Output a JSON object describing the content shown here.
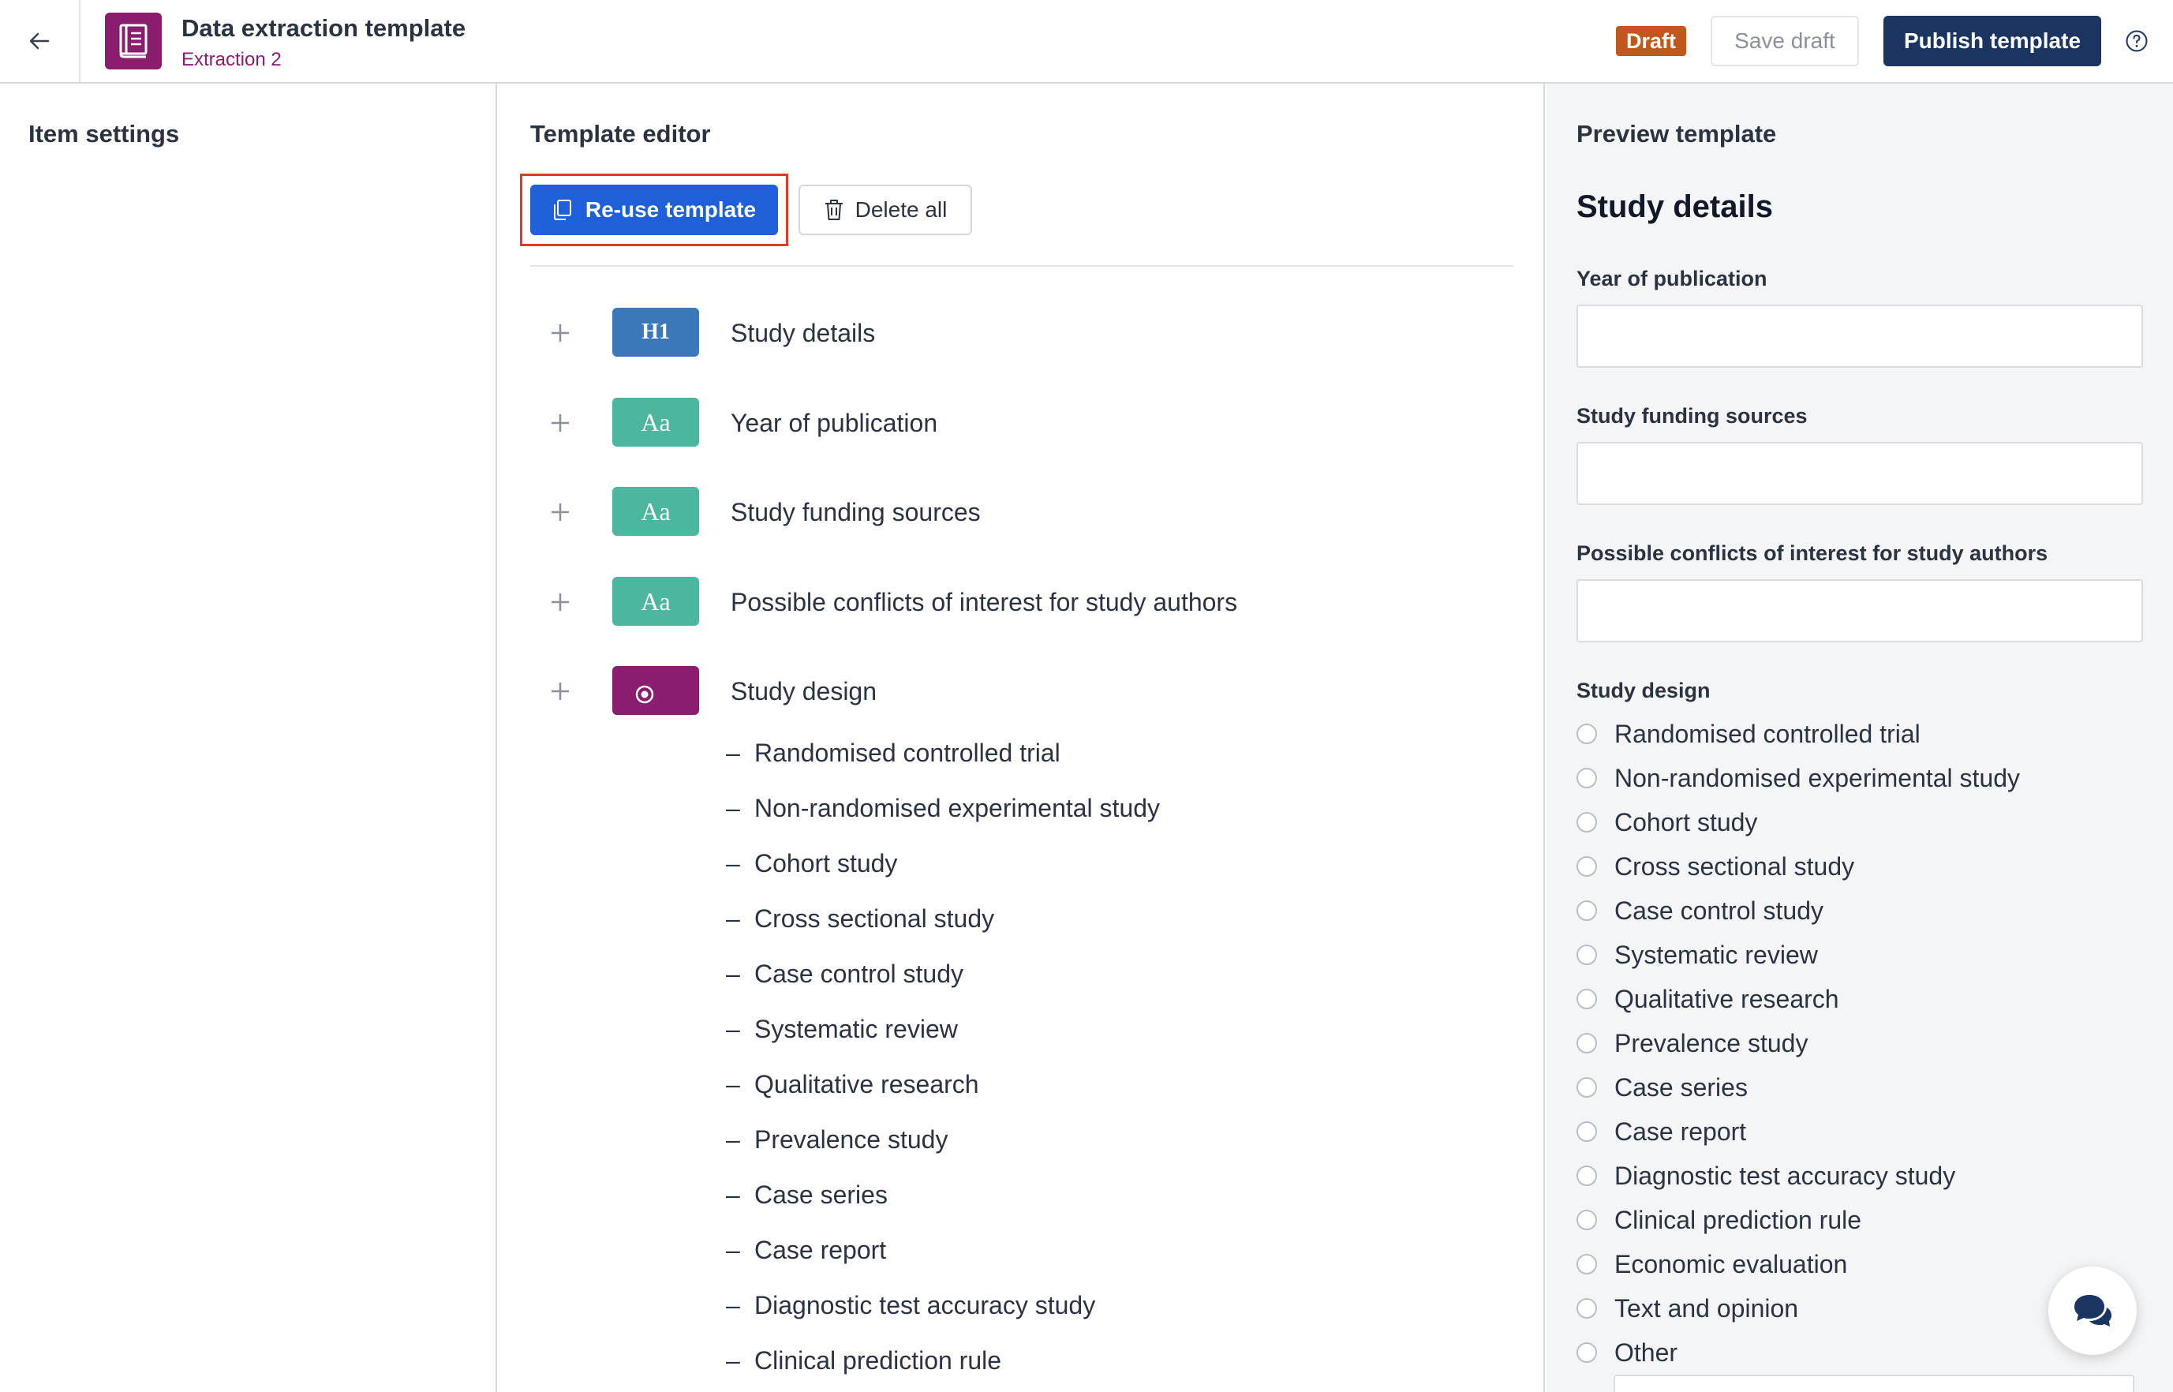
{
  "header": {
    "title": "Data extraction template",
    "subtitle": "Extraction 2",
    "draft_badge": "Draft",
    "save_draft_label": "Save draft",
    "publish_label": "Publish template",
    "icons": {
      "back": "arrow-left-icon",
      "logo": "book-icon",
      "help": "question-circle-icon"
    }
  },
  "left_panel": {
    "title": "Item settings"
  },
  "center_panel": {
    "title": "Template editor",
    "reuse_label": "Re-use template",
    "delete_label": "Delete all",
    "items": [
      {
        "type_icon": "H1",
        "label": "Study details"
      },
      {
        "type_icon": "Aa",
        "label": "Year of publication"
      },
      {
        "type_icon": "Aa",
        "label": "Study funding sources"
      },
      {
        "type_icon": "Aa",
        "label": "Possible conflicts of interest for study authors"
      },
      {
        "type_icon": "radio",
        "label": "Study design"
      }
    ],
    "option_dash": "–",
    "options": [
      "Randomised controlled trial",
      "Non-randomised experimental study",
      "Cohort study",
      "Cross sectional study",
      "Case control study",
      "Systematic review",
      "Qualitative research",
      "Prevalence study",
      "Case series",
      "Case report",
      "Diagnostic test accuracy study",
      "Clinical prediction rule"
    ]
  },
  "right_panel": {
    "title": "Preview template",
    "heading": "Study details",
    "fields": [
      {
        "label": "Year of publication"
      },
      {
        "label": "Study funding sources"
      },
      {
        "label": "Possible conflicts of interest for study authors"
      }
    ],
    "radio_group_label": "Study design",
    "radio_options": [
      "Randomised controlled trial",
      "Non-randomised experimental study",
      "Cohort study",
      "Cross sectional study",
      "Case control study",
      "Systematic review",
      "Qualitative research",
      "Prevalence study",
      "Case series",
      "Case report",
      "Diagnostic test accuracy study",
      "Clinical prediction rule",
      "Economic evaluation",
      "Text and opinion",
      "Other"
    ]
  },
  "colors": {
    "brand": "#8a1d6e",
    "primary_button": "#1f5fd8",
    "publish_button": "#1b3560",
    "draft_badge": "#c0571c",
    "highlight_outline": "#e23a25",
    "heading_chip": "#3a78b8",
    "text_chip": "#4cb69e"
  }
}
